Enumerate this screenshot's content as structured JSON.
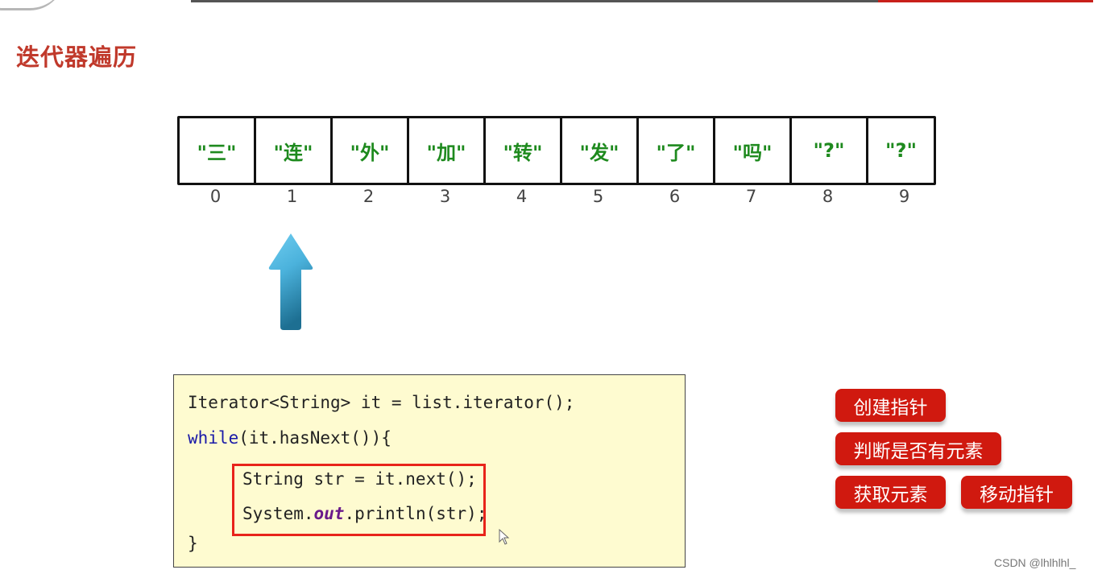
{
  "slide": {
    "title": "迭代器遍历",
    "colors": {
      "title": "#c0392b",
      "element_text": "#1e8a1e",
      "tag_bg": "#d0190f",
      "code_bg": "#fefbd0",
      "highlight_border": "#e8231a",
      "keyword": "#1a1aa8",
      "static_field": "#6a1a8a"
    }
  },
  "array": {
    "elements": [
      "\"三\"",
      "\"连\"",
      "\"外\"",
      "\"加\"",
      "\"转\"",
      "\"发\"",
      "\"了\"",
      "\"吗\"",
      "\"?\"",
      "\"?\""
    ],
    "indices": [
      "0",
      "1",
      "2",
      "3",
      "4",
      "5",
      "6",
      "7",
      "8",
      "9"
    ],
    "pointer_index": 1,
    "pointer_icon": "up-arrow-icon"
  },
  "code": {
    "line1": "Iterator<String> it = list.iterator();",
    "line2_kw": "while",
    "line2_rest": "(it.hasNext()){",
    "line3": "String str = it.next();",
    "line4_a": "System.",
    "line4_field": "out",
    "line4_b": ".println(str);",
    "line5": "}"
  },
  "tags": {
    "create_pointer": "创建指针",
    "has_next": "判断是否有元素",
    "get_element": "获取元素",
    "move_pointer": "移动指针"
  },
  "watermark": "CSDN @lhlhlhl_"
}
